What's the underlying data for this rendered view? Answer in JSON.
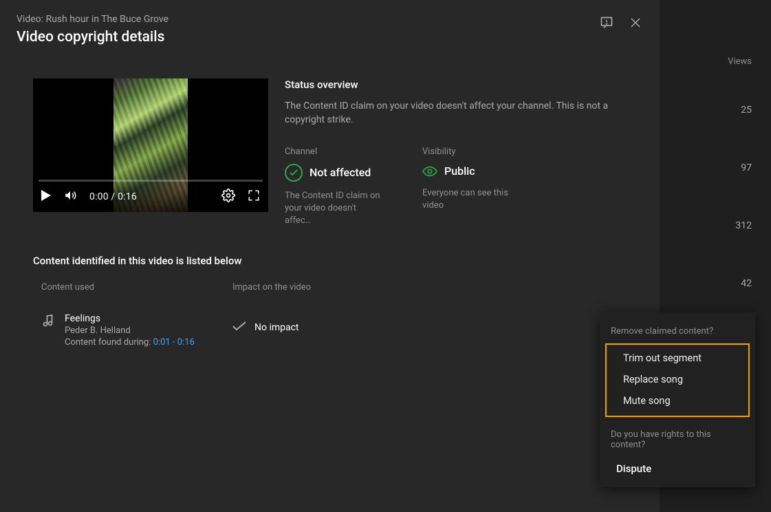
{
  "header": {
    "subtitle": "Video: Rush hour in The Buce Grove",
    "title": "Video copyright details"
  },
  "status": {
    "heading": "Status overview",
    "description": "The Content ID claim on your video doesn't affect your channel. This is not a copyright strike.",
    "channel": {
      "label": "Channel",
      "value": "Not affected",
      "sub": "The Content ID claim on your video doesn't affec…"
    },
    "visibility": {
      "label": "Visibility",
      "value": "Public",
      "sub": "Everyone can see this video"
    }
  },
  "player": {
    "time": "0:00 / 0:16"
  },
  "section": {
    "title": "Content identified in this video is listed below",
    "col1": "Content used",
    "col2": "Impact on the video"
  },
  "claim": {
    "title": "Feelings",
    "artist": "Peder B. Helland",
    "found_prefix": "Content found during: ",
    "range": "0:01 - 0:16",
    "impact": "No impact"
  },
  "popup": {
    "remove_label": "Remove claimed content?",
    "items": [
      "Trim out segment",
      "Replace song",
      "Mute song"
    ],
    "rights_label": "Do you have rights to this content?",
    "dispute": "Dispute"
  },
  "sidebar": {
    "header": "Views",
    "values": [
      "25",
      "97",
      "312",
      "42"
    ]
  }
}
